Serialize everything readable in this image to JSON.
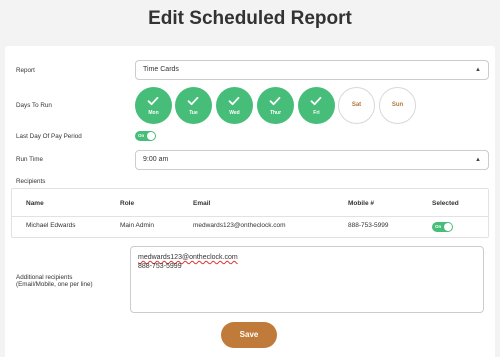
{
  "page": {
    "title": "Edit Scheduled Report"
  },
  "form": {
    "report_label": "Report",
    "report_value": "Time Cards",
    "days_label": "Days To Run",
    "days": [
      {
        "name": "Mon",
        "selected": true
      },
      {
        "name": "Tue",
        "selected": true
      },
      {
        "name": "Wed",
        "selected": true
      },
      {
        "name": "Thur",
        "selected": true
      },
      {
        "name": "Fri",
        "selected": true
      },
      {
        "name": "Sat",
        "selected": false
      },
      {
        "name": "Sun",
        "selected": false
      }
    ],
    "last_day_label": "Last Day Of Pay Period",
    "last_day_toggle": "On",
    "run_time_label": "Run Time",
    "run_time_value": "9:00 am",
    "recipients_label": "Recipients",
    "additional_label_line1": "Additional recipients",
    "additional_label_line2": "(Email/Mobile, one per line)",
    "additional_lines": [
      "medwards123@ontheclock.com",
      "888-753-5999"
    ],
    "save_label": "Save"
  },
  "recipients_table": {
    "headers": [
      "Name",
      "Role",
      "Email",
      "Mobile #",
      "Selected"
    ],
    "rows": [
      {
        "name": "Michael Edwards",
        "role": "Main Admin",
        "email": "medwards123@ontheclock.com",
        "mobile": "888-753-5999",
        "selected": "On"
      }
    ]
  },
  "colors": {
    "accent_green": "#46bd78",
    "brand_brown": "#c07a3a",
    "off_day_text": "#b4763e"
  },
  "icons": {
    "caret": "updown-caret-icon",
    "check": "check-icon"
  }
}
